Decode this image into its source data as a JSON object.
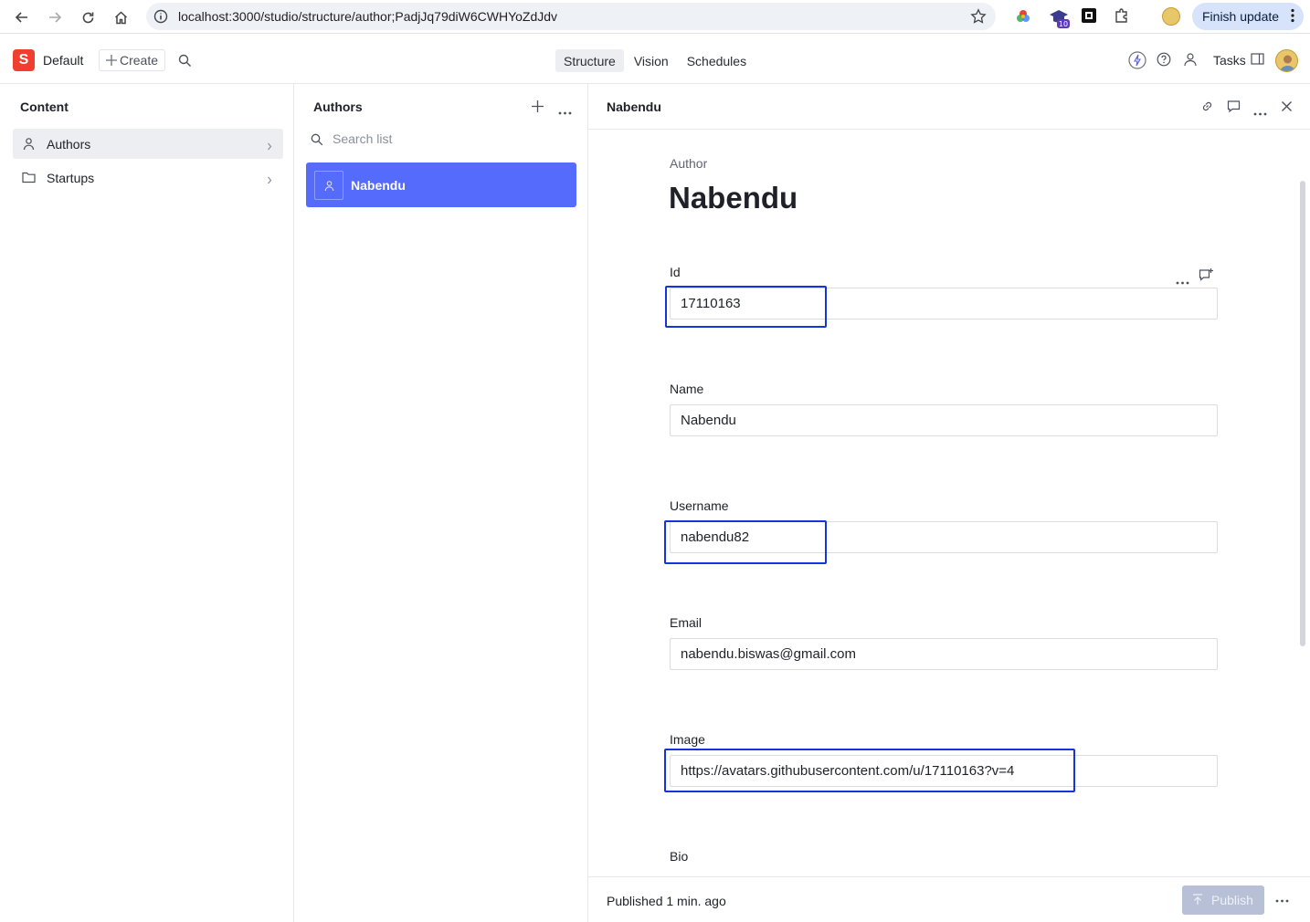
{
  "browser": {
    "url": "localhost:3000/studio/structure/author;PadjJq79diW6CWHYoZdJdv",
    "finish_update_label": "Finish update",
    "extension_badge": "10"
  },
  "header": {
    "logo_letter": "S",
    "workspace": "Default",
    "create_label": "Create",
    "tabs": [
      {
        "label": "Structure",
        "active": true
      },
      {
        "label": "Vision",
        "active": false
      },
      {
        "label": "Schedules",
        "active": false
      }
    ],
    "tasks_label": "Tasks"
  },
  "content_pane": {
    "title": "Content",
    "items": [
      {
        "label": "Authors",
        "selected": true
      },
      {
        "label": "Startups",
        "selected": false
      }
    ]
  },
  "list_pane": {
    "title": "Authors",
    "search_placeholder": "Search list",
    "items": [
      {
        "label": "Nabendu",
        "selected": true
      }
    ]
  },
  "document": {
    "header_title": "Nabendu",
    "type_label": "Author",
    "title": "Nabendu",
    "fields": {
      "id": {
        "label": "Id",
        "value": "17110163"
      },
      "name": {
        "label": "Name",
        "value": "Nabendu"
      },
      "username": {
        "label": "Username",
        "value": "nabendu82"
      },
      "email": {
        "label": "Email",
        "value": "nabendu.biswas@gmail.com"
      },
      "image": {
        "label": "Image",
        "value": "https://avatars.githubusercontent.com/u/17110163?v=4"
      },
      "bio": {
        "label": "Bio"
      }
    },
    "status": "Published 1 min. ago",
    "publish_label": "Publish"
  },
  "colors": {
    "brand": "#f03e2f",
    "selected_item": "#556bfc",
    "highlight": "#1534e0",
    "publish_disabled": "#b7c0d6"
  }
}
